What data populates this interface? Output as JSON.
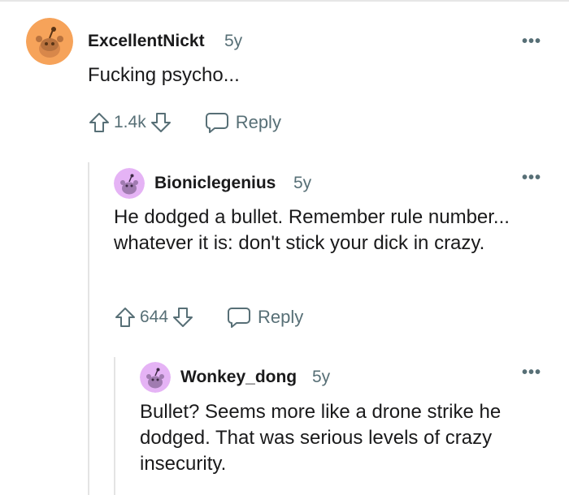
{
  "comments": [
    {
      "username": "ExcellentNickt",
      "age": "5y",
      "body": "Fucking psycho...",
      "score": "1.4k",
      "reply_label": "Reply",
      "avatar_color": "#f6a35a"
    },
    {
      "username": "Bioniclegenius",
      "age": "5y",
      "body": "He dodged a bullet. Remember rule number... whatever it is: don't stick your dick in crazy.",
      "score": "644",
      "reply_label": "Reply",
      "avatar_color": "#e5b3f5"
    },
    {
      "username": "Wonkey_dong",
      "age": "5y",
      "body": "Bullet? Seems more like a drone strike he dodged. That was serious levels of crazy insecurity.",
      "avatar_color": "#e5b3f5"
    }
  ],
  "more_glyph": "•••",
  "colors": {
    "meta": "#576f76",
    "thread_line": "#e4e4e4"
  }
}
